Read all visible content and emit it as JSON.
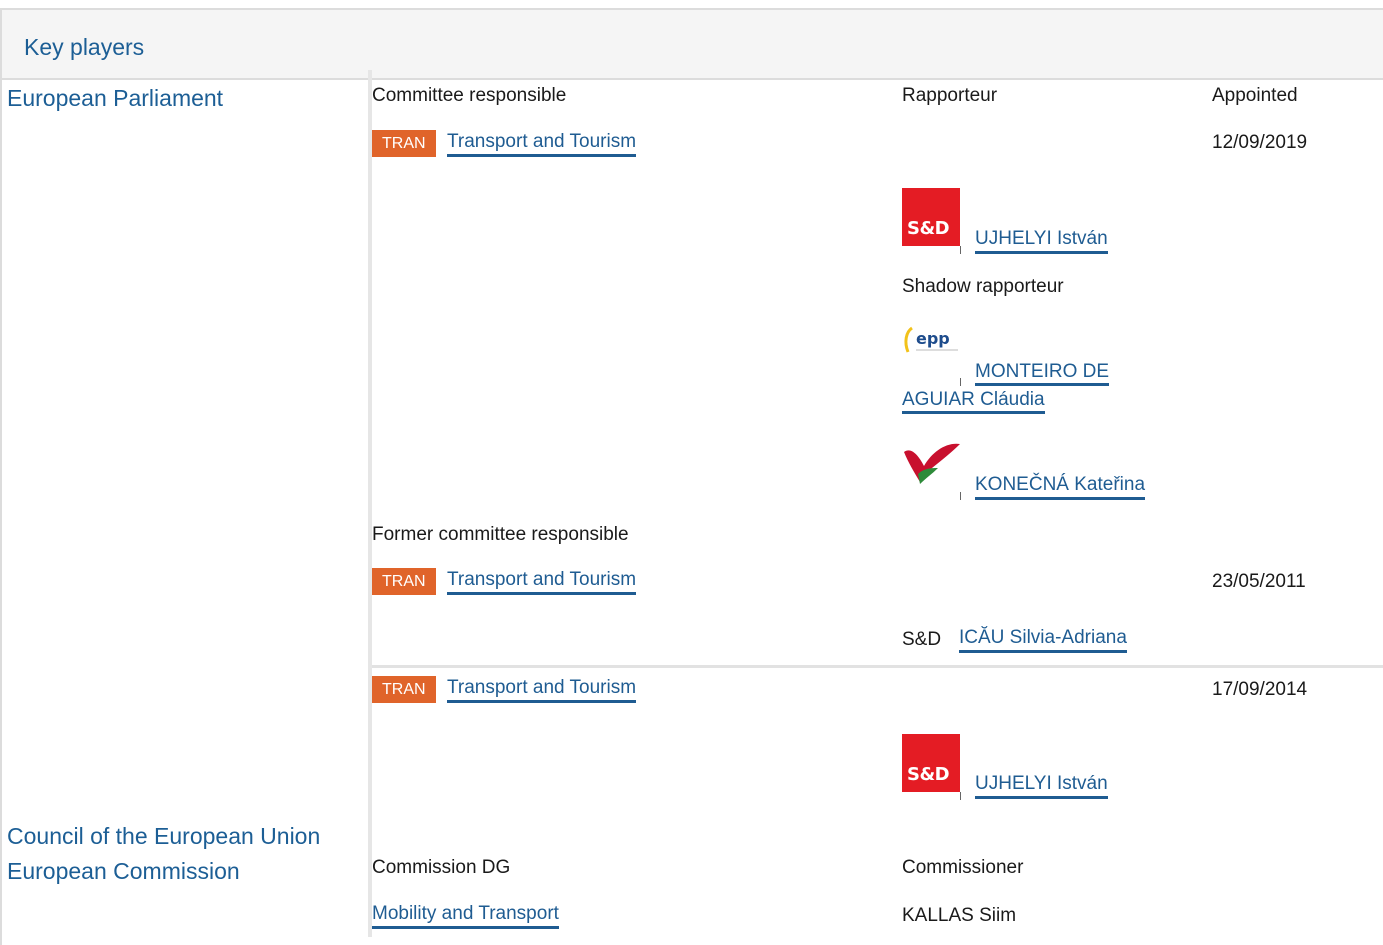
{
  "header": {
    "title": "Key players"
  },
  "institutions": {
    "parliament": "European Parliament",
    "council": "Council of the European Union",
    "commission": "European Commission"
  },
  "columns": {
    "committee_responsible": "Committee responsible",
    "rapporteur": "Rapporteur",
    "appointed": "Appointed",
    "shadow_rapporteur": "Shadow rapporteur",
    "former_committee_responsible": "Former committee responsible",
    "commission_dg": "Commission DG",
    "commissioner": "Commissioner"
  },
  "current": {
    "badge": "TRAN",
    "committee": "Transport and Tourism",
    "appointed": "12/09/2019",
    "rapporteur": {
      "group_logo": "sd-logo",
      "logo_text": "S&D",
      "name": "UJHELYI István"
    },
    "shadows": [
      {
        "group_logo": "epp-logo",
        "logo_text": "epp",
        "name_line1": "MONTEIRO DE",
        "name_line2": "AGUIAR Cláudia"
      },
      {
        "group_logo": "left-logo",
        "name": "KONEČNÁ Kateřina"
      }
    ]
  },
  "former": [
    {
      "badge": "TRAN",
      "committee": "Transport and Tourism",
      "appointed": "23/05/2011",
      "rapporteur": {
        "group": "S&D",
        "name": "ICĂU Silvia-Adriana"
      }
    },
    {
      "badge": "TRAN",
      "committee": "Transport and Tourism",
      "appointed": "17/09/2014",
      "rapporteur": {
        "group_logo": "sd-logo",
        "logo_text": "S&D",
        "name": "UJHELYI István"
      }
    }
  ],
  "commission": {
    "dg": "Mobility and Transport",
    "commissioner": "KALLAS Siim"
  },
  "colors": {
    "link": "#1f5c92",
    "badge": "#e0642a",
    "sd_red": "#e41c24"
  }
}
